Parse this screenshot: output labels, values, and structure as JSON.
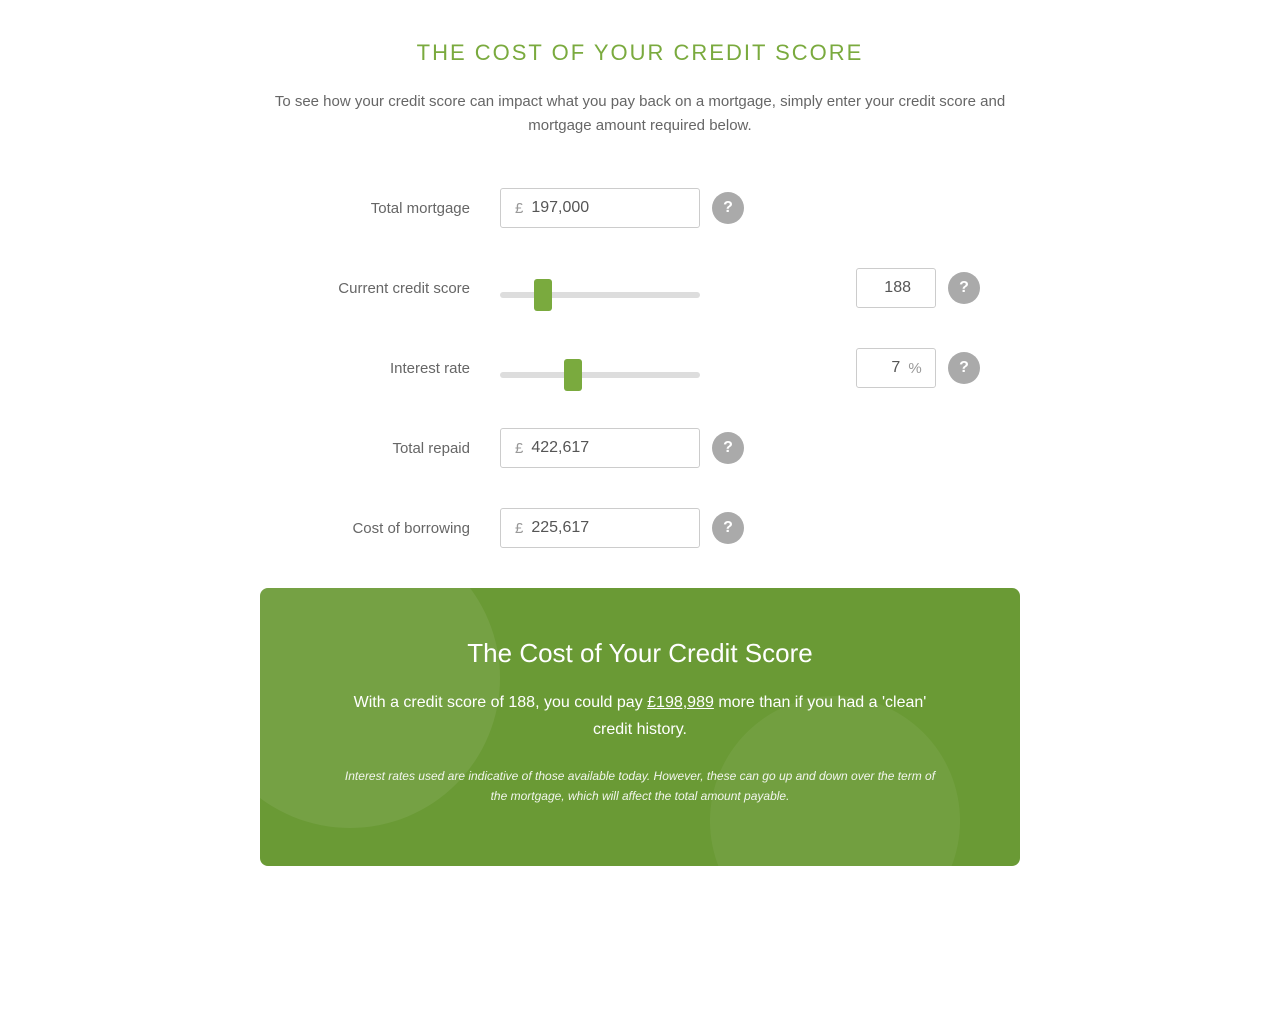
{
  "page": {
    "title": "THE COST OF YOUR CREDIT SCORE",
    "subtitle": "To see how your credit score can impact what you pay back on a mortgage, simply enter your credit score and mortgage amount required below."
  },
  "form": {
    "total_mortgage": {
      "label": "Total mortgage",
      "currency_symbol": "£",
      "value": "197,000"
    },
    "credit_score": {
      "label": "Current credit score",
      "value": "188",
      "min": 0,
      "max": 999,
      "current": 188
    },
    "interest_rate": {
      "label": "Interest rate",
      "value": "7",
      "suffix": "%",
      "min": 0,
      "max": 20,
      "current": 7
    },
    "total_repaid": {
      "label": "Total repaid",
      "currency_symbol": "£",
      "value": "422,617"
    },
    "cost_of_borrowing": {
      "label": "Cost of borrowing",
      "currency_symbol": "£",
      "value": "225,617"
    }
  },
  "info_card": {
    "title": "The Cost of Your Credit Score",
    "body_prefix": "With a credit score of ",
    "credit_score": "188",
    "body_middle": ", you could pay ",
    "highlighted_amount": "£198,989",
    "body_suffix": " more than if you had a 'clean' credit history.",
    "footnote": "Interest rates used are indicative of those available today. However, these can go up and down over the term of the mortgage, which will affect the total amount payable."
  },
  "icons": {
    "help": "?"
  },
  "colors": {
    "green": "#7aaa3e",
    "dark_green": "#6a9a35",
    "gray": "#aaa"
  }
}
